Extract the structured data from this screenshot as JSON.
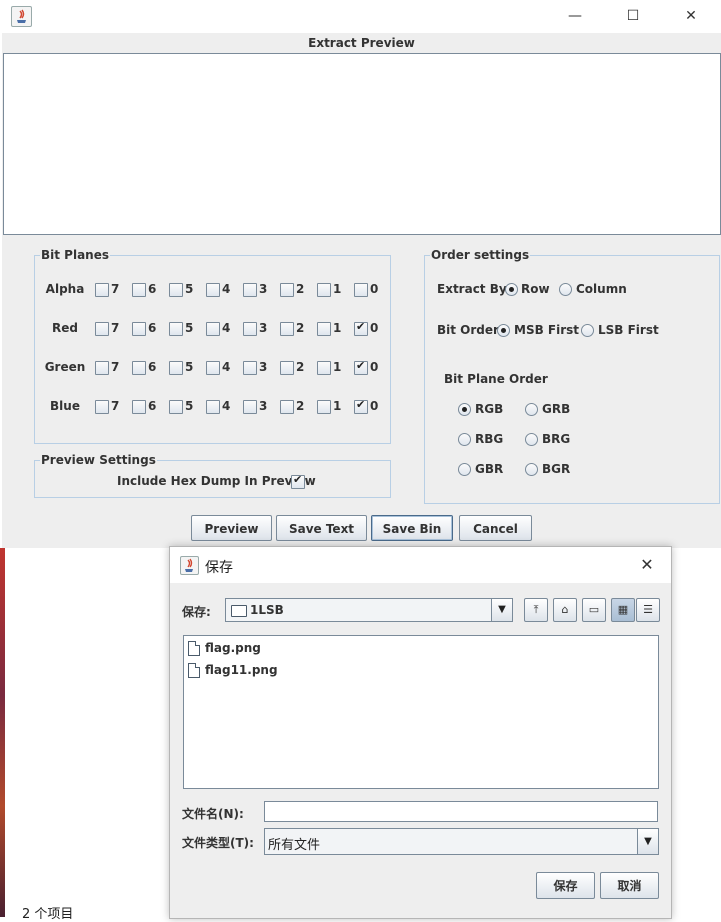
{
  "main_window": {
    "title_controls": {
      "minimize": "—",
      "maximize": "☐",
      "close": "✕"
    },
    "preview_title": "Extract Preview",
    "bit_planes": {
      "title": "Bit Planes",
      "rows": [
        {
          "label": "Alpha",
          "checked": [
            false,
            false,
            false,
            false,
            false,
            false,
            false,
            false
          ]
        },
        {
          "label": "Red",
          "checked": [
            false,
            false,
            false,
            false,
            false,
            false,
            false,
            true
          ]
        },
        {
          "label": "Green",
          "checked": [
            false,
            false,
            false,
            false,
            false,
            false,
            false,
            true
          ]
        },
        {
          "label": "Blue",
          "checked": [
            false,
            false,
            false,
            false,
            false,
            false,
            false,
            true
          ]
        }
      ],
      "bits": [
        "7",
        "6",
        "5",
        "4",
        "3",
        "2",
        "1",
        "0"
      ]
    },
    "preview_settings": {
      "title": "Preview Settings",
      "hex_dump_label": "Include Hex Dump In Preview",
      "hex_dump_checked": true
    },
    "order_settings": {
      "title": "Order settings",
      "extract_by_label": "Extract By",
      "extract_by_options": [
        "Row",
        "Column"
      ],
      "extract_by_selected": "Row",
      "bit_order_label": "Bit Order",
      "bit_order_options": [
        "MSB First",
        "LSB First"
      ],
      "bit_order_selected": "MSB First",
      "plane_order_label": "Bit Plane Order",
      "plane_order_options": [
        "RGB",
        "GRB",
        "RBG",
        "BRG",
        "GBR",
        "BGR"
      ],
      "plane_order_selected": "RGB"
    },
    "buttons": {
      "preview": "Preview",
      "save_text": "Save Text",
      "save_bin": "Save Bin",
      "cancel": "Cancel"
    }
  },
  "save_dialog": {
    "title": "保存",
    "close": "✕",
    "save_in_label": "保存:",
    "current_folder": "1LSB",
    "files": [
      "flag.png",
      "flag11.png"
    ],
    "filename_label": "文件名(N):",
    "filename_value": "",
    "filetype_label": "文件类型(T):",
    "filetype_value": "所有文件",
    "save_button": "保存",
    "cancel_button": "取消"
  },
  "background": {
    "status_text": "2 个项目"
  }
}
